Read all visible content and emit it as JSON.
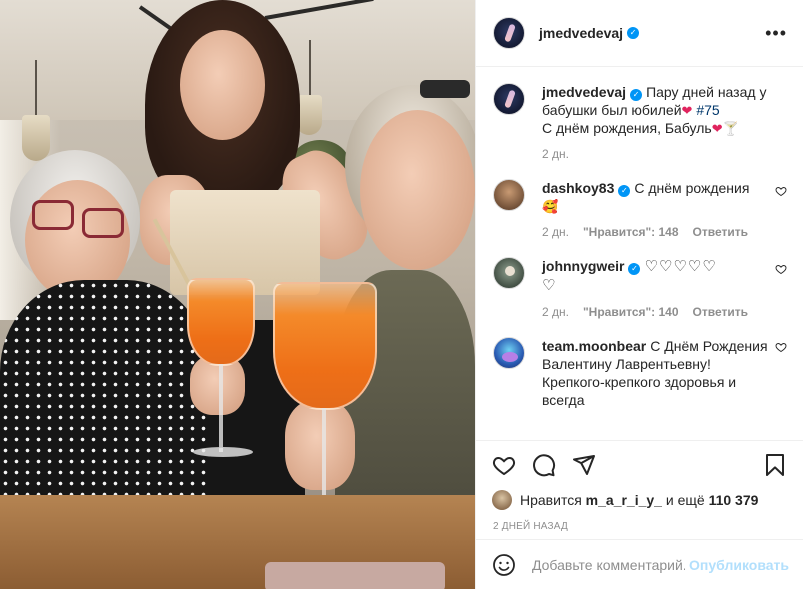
{
  "header": {
    "username": "jmedvedevaj",
    "verified": true,
    "more_icon": "more-horizontal-icon"
  },
  "caption": {
    "username": "jmedvedevaj",
    "text_line1": "Пару дней назад у бабушки был юбилей",
    "hashtag": "#75",
    "text_line2": "С днём рождения, Бабуль",
    "time": "2 дн."
  },
  "comments": [
    {
      "username": "dashkoy83",
      "text": "С днём рождения",
      "emoji": "🥰",
      "time": "2 дн.",
      "likes_label": "\"Нравится\": 148",
      "reply_label": "Ответить"
    },
    {
      "username": "johnnygweir",
      "text": "♡♡♡♡♡",
      "text2": "♡",
      "time": "2 дн.",
      "likes_label": "\"Нравится\": 140",
      "reply_label": "Ответить"
    },
    {
      "username": "team.moonbear",
      "text": "С Днём Рождения Валентину Лаврентьевну! Крепкого-крепкого здоровья и всегда"
    }
  ],
  "likes": {
    "prefix": "Нравится",
    "user": "m_a_r_i_y_",
    "suffix": "и ещё",
    "count": "110 379"
  },
  "date": "2 дней назад",
  "add_comment": {
    "placeholder": "Добавьте комментарий...",
    "publish_label": "Опубликовать"
  },
  "colors": {
    "accent": "#0095f6",
    "publish_disabled": "#b2dffc",
    "heart": "#e0245e",
    "muted": "#8e8e8e"
  }
}
